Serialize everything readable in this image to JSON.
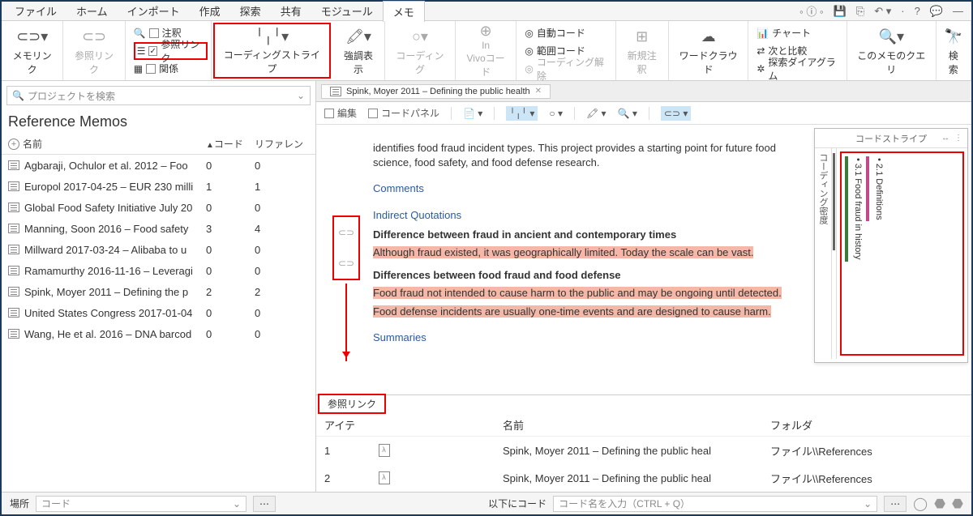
{
  "menu": [
    "ファイル",
    "ホーム",
    "インポート",
    "作成",
    "探索",
    "共有",
    "モジュール",
    "メモ"
  ],
  "menu_active": 7,
  "ribbon": {
    "memolink": "メモリンク",
    "reflink": "参照リンク",
    "ann": "注釈",
    "reflink2": "参照リンク",
    "rel": "関係",
    "coding_stripe": "コーディングストライプ",
    "highlight": "強調表示",
    "coding": "コーディング",
    "invivo": "In\nVivoコード",
    "autocode": "自動コード",
    "rangecode": "範囲コード",
    "uncoding": "コーディング解除",
    "newann": "新規注釈",
    "wordcloud": "ワードクラウド",
    "chart": "チャート",
    "compare": "次と比較",
    "explore": "探索ダイアグラム",
    "memoquery": "このメモのクエリ",
    "search": "検索"
  },
  "search_placeholder": "プロジェクトを検索",
  "panel_title": "Reference Memos",
  "list_headers": {
    "name": "名前",
    "code": "コード",
    "ref": "リファレン"
  },
  "list": [
    {
      "name": "Agbaraji, Ochulor et al. 2012 – Foo",
      "code": "0",
      "ref": "0"
    },
    {
      "name": "Europol  2017-04-25 – EUR 230 milli",
      "code": "1",
      "ref": "1"
    },
    {
      "name": "Global Food Safety Initiative July 20",
      "code": "0",
      "ref": "0"
    },
    {
      "name": "Manning,  Soon  2016 – Food safety",
      "code": "3",
      "ref": "4"
    },
    {
      "name": "Millward  2017-03-24 – Alibaba to u",
      "code": "0",
      "ref": "0"
    },
    {
      "name": "Ramamurthy  2016-11-16 – Leveragi",
      "code": "0",
      "ref": "0"
    },
    {
      "name": "Spink,  Moyer  2011 – Defining the p",
      "code": "2",
      "ref": "2"
    },
    {
      "name": "United States Congress 2017-01-04",
      "code": "0",
      "ref": "0"
    },
    {
      "name": "Wang, He et al. 2016 – DNA barcod",
      "code": "0",
      "ref": "0"
    }
  ],
  "tab_title": "Spink, Moyer 2011 – Defining the public health",
  "doc_toolbar": {
    "edit": "編集",
    "codepanel": "コードパネル"
  },
  "doc": {
    "intro": "identifies food fraud incident types. This project provides a starting point for future food science, food safety, and food defense research.",
    "comments": "Comments",
    "indirect": "Indirect Quotations",
    "h1": "Difference between fraud in ancient and contemporary times",
    "p1": "Although fraud existed, it was geographically limited. Today the scale can be vast.",
    "h2": "Differences between food fraud and food defense",
    "p2a": "Food fraud not intended to cause harm to the public and may be ongoing until detected.",
    "p2b": "Food defense incidents are usually one-time events and are designed to cause harm.",
    "summaries": "Summaries"
  },
  "stripe": {
    "title": "コードストライプ",
    "density": "コーディング密度",
    "code1": "• 3.1 Food fraud in history",
    "code2": "• 2.1 Definitions"
  },
  "ref_tab": "参照リンク",
  "ref_headers": {
    "item": "アイテ",
    "name": "名前",
    "folder": "フォルダ"
  },
  "ref_rows": [
    {
      "n": "1",
      "name": "Spink,  Moyer  2011 – Defining the public heal",
      "folder": "ファイル\\\\References"
    },
    {
      "n": "2",
      "name": "Spink,  Moyer  2011 – Defining the public heal",
      "folder": "ファイル\\\\References"
    }
  ],
  "footer": {
    "place": "場所",
    "code": "コード",
    "codeat": "以下にコード",
    "codeinput": "コード名を入力（CTRL + Q）"
  }
}
